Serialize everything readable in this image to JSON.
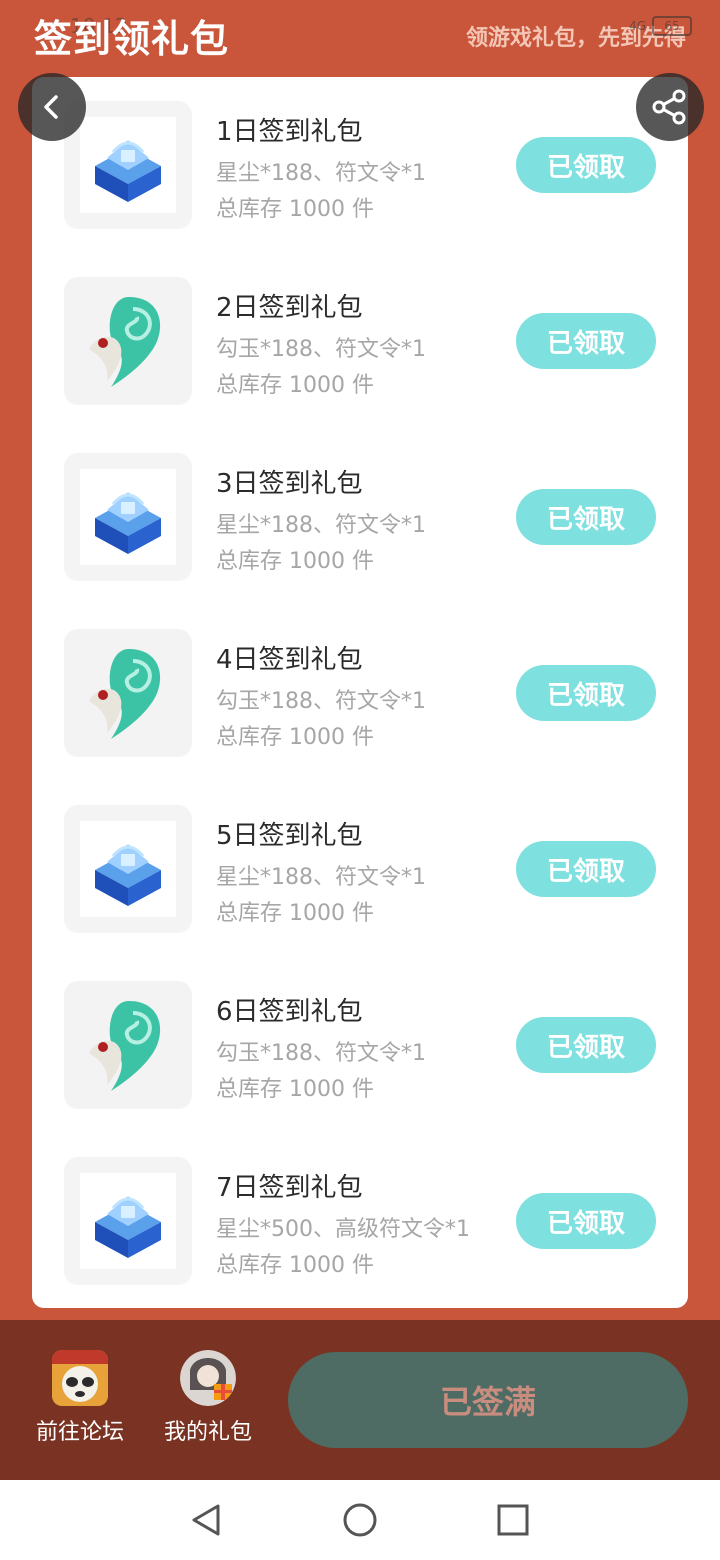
{
  "status_bar": {
    "time": "10:12",
    "network": "4G",
    "battery": "65"
  },
  "header": {
    "title": "签到领礼包",
    "slogan": "领游戏礼包，先到先得"
  },
  "gifts": [
    {
      "title": "1日签到礼包",
      "desc": "星尘*188、符文令*1",
      "stock": "总库存 1000 件",
      "button": "已领取",
      "icon": "blue-chest-icon"
    },
    {
      "title": "2日签到礼包",
      "desc": "勾玉*188、符文令*1",
      "stock": "总库存 1000 件",
      "button": "已领取",
      "icon": "jade-magatama-icon"
    },
    {
      "title": "3日签到礼包",
      "desc": "星尘*188、符文令*1",
      "stock": "总库存 1000 件",
      "button": "已领取",
      "icon": "blue-chest-icon"
    },
    {
      "title": "4日签到礼包",
      "desc": "勾玉*188、符文令*1",
      "stock": "总库存 1000 件",
      "button": "已领取",
      "icon": "jade-magatama-icon"
    },
    {
      "title": "5日签到礼包",
      "desc": "星尘*188、符文令*1",
      "stock": "总库存 1000 件",
      "button": "已领取",
      "icon": "blue-chest-icon"
    },
    {
      "title": "6日签到礼包",
      "desc": "勾玉*188、符文令*1",
      "stock": "总库存 1000 件",
      "button": "已领取",
      "icon": "jade-magatama-icon"
    },
    {
      "title": "7日签到礼包",
      "desc": "星尘*500、高级符文令*1",
      "stock": "总库存 1000 件",
      "button": "已领取",
      "icon": "blue-chest-icon"
    }
  ],
  "bottom_bar": {
    "forum_label": "前往论坛",
    "my_gifts_label": "我的礼包",
    "signed_label": "已签满"
  },
  "colors": {
    "background": "#c9553a",
    "bottom_bar": "#7a3323",
    "claimed_button": "#7fe0e0",
    "signed_button": "#4e6b64"
  }
}
